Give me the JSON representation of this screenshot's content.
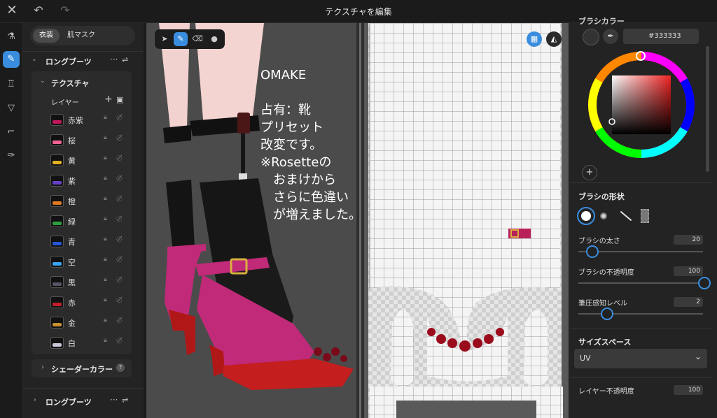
{
  "header": {
    "title": "テクスチャを編集"
  },
  "left_panel": {
    "segments": [
      "衣装",
      "肌マスク"
    ],
    "section_title": "ロングブーツ",
    "texture_title": "テクスチャ",
    "layers_label": "レイヤー",
    "layers": [
      {
        "name": "赤紫",
        "color": "#c2185b"
      },
      {
        "name": "桜",
        "color": "#f06292"
      },
      {
        "name": "黄",
        "color": "#e0b020"
      },
      {
        "name": "紫",
        "color": "#6a3fc8"
      },
      {
        "name": "橙",
        "color": "#e07820"
      },
      {
        "name": "緑",
        "color": "#2e9e3e"
      },
      {
        "name": "青",
        "color": "#2456d8"
      },
      {
        "name": "空",
        "color": "#3aa6f0"
      },
      {
        "name": "黒",
        "color": "#555566"
      },
      {
        "name": "赤",
        "color": "#c41e2a"
      },
      {
        "name": "金",
        "color": "#c89030"
      },
      {
        "name": "白",
        "color": "#c8c8d8"
      }
    ],
    "shader_color_label": "シェーダーカラー",
    "section_title_2": "ロングブーツ"
  },
  "viewport": {
    "overlay_text": "OMAKE\n\n占有：靴\nプリセット\n改変です。\n※Rosetteの\n　おまけから\n　さらに色違い\n　が増えました。"
  },
  "right_panel": {
    "color_section_label": "ブラシカラー",
    "hex_value": "#333333",
    "brush_shape_label": "ブラシの形状",
    "brush_size": {
      "label": "ブラシの太さ",
      "value": "20",
      "fraction": 0.1
    },
    "brush_opacity": {
      "label": "ブラシの不透明度",
      "value": "100",
      "fraction": 1.0
    },
    "pressure": {
      "label": "筆圧感知レベル",
      "value": "2",
      "fraction": 0.22
    },
    "size_space_label": "サイズスペース",
    "size_space_value": "UV",
    "layer_opacity": {
      "label": "レイヤー不透明度",
      "value": "100"
    }
  },
  "colors": {
    "accent": "#3a8dde",
    "shoe": "#c02a78",
    "heel": "#b01818"
  }
}
